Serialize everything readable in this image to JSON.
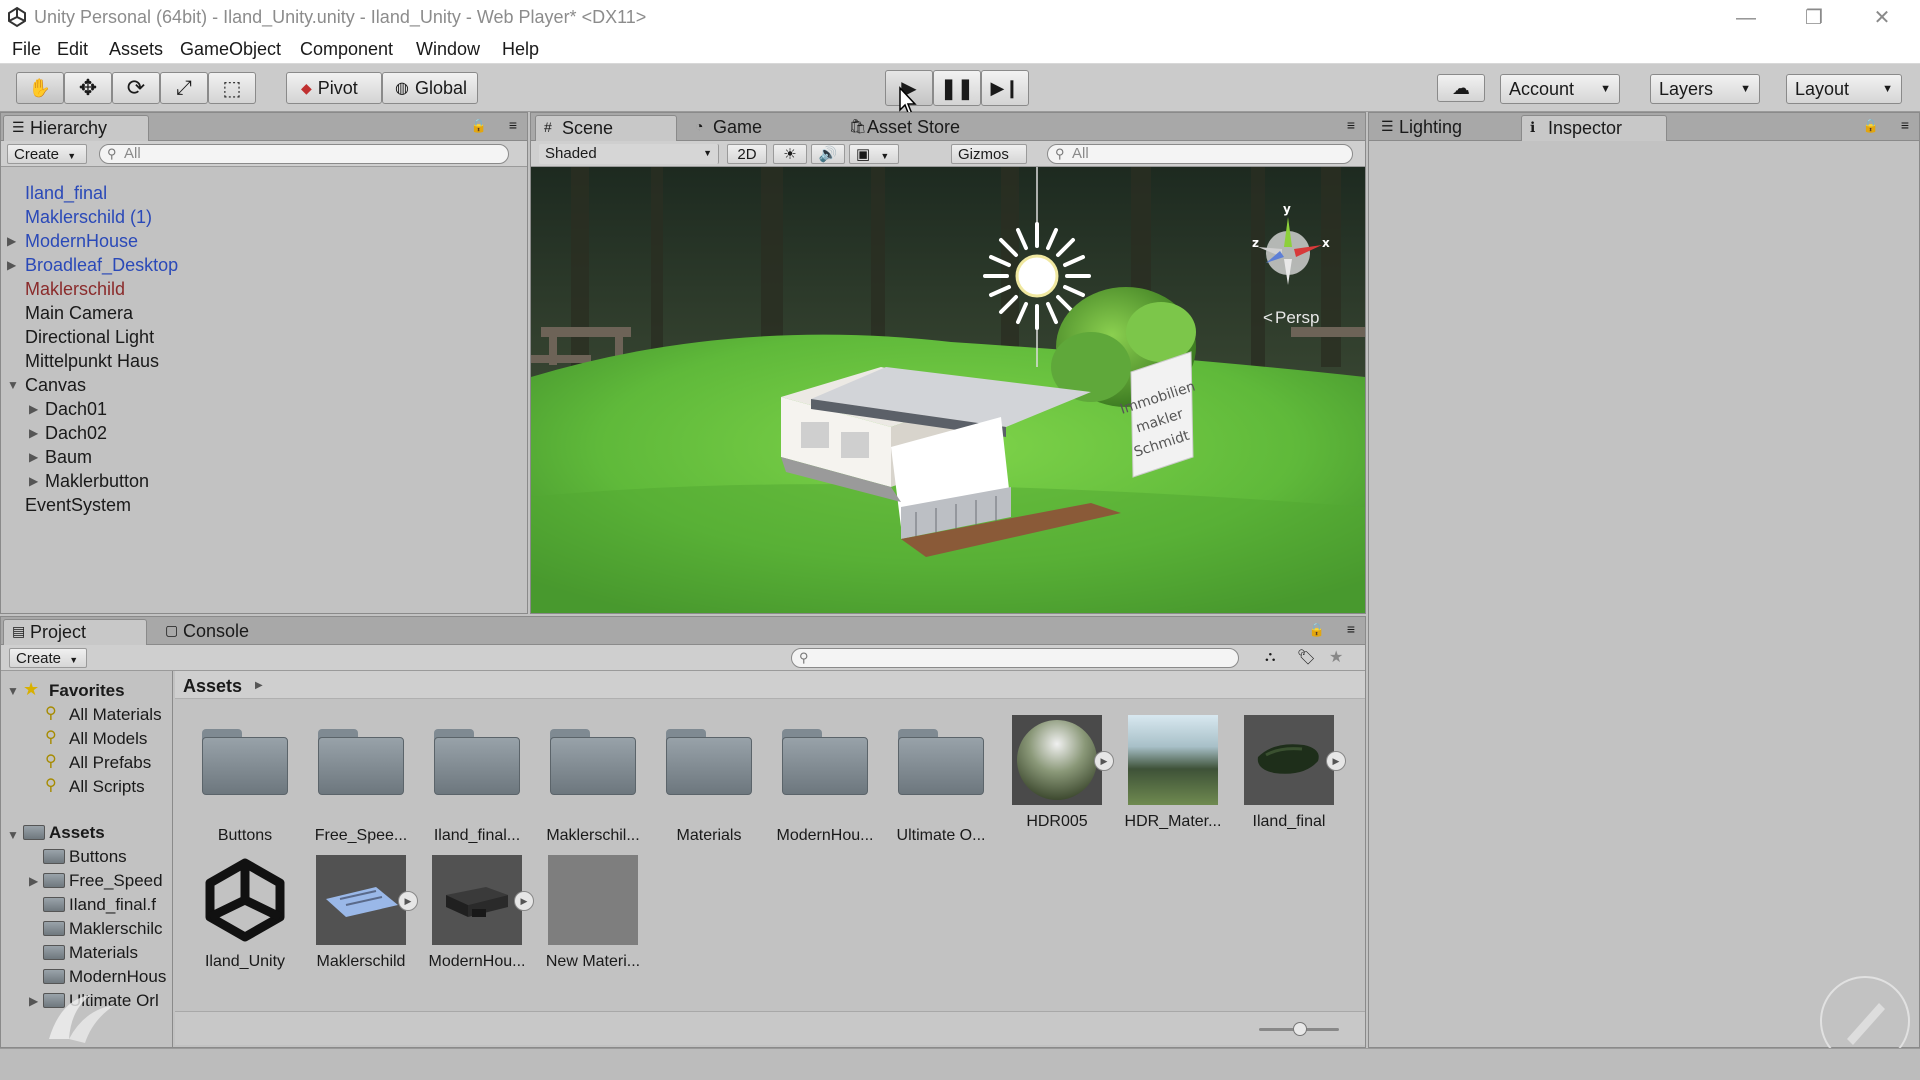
{
  "window": {
    "title": "Unity Personal (64bit) - Iland_Unity.unity - Iland_Unity - Web Player* <DX11>",
    "minimize_glyph": "—",
    "restore_glyph": "❐",
    "close_glyph": "✕"
  },
  "menu": [
    "File",
    "Edit",
    "Assets",
    "GameObject",
    "Component",
    "Window",
    "Help"
  ],
  "toolbar": {
    "pivot_label": "Pivot",
    "global_label": "Global",
    "account_label": "Account",
    "layers_label": "Layers",
    "layout_label": "Layout"
  },
  "hierarchy": {
    "tab_label": "Hierarchy",
    "create_label": "Create",
    "search_placeholder": "All",
    "items": [
      {
        "label": "Iland_final"
      },
      {
        "label": "Maklerschild (1)"
      },
      {
        "label": "ModernHouse"
      },
      {
        "label": "Broadleaf_Desktop"
      },
      {
        "label": "Maklerschild"
      },
      {
        "label": "Main Camera"
      },
      {
        "label": "Directional Light"
      },
      {
        "label": "Mittelpunkt Haus"
      },
      {
        "label": "Canvas"
      },
      {
        "label": "Dach01"
      },
      {
        "label": "Dach02"
      },
      {
        "label": "Baum"
      },
      {
        "label": "Maklerbutton"
      },
      {
        "label": "EventSystem"
      }
    ]
  },
  "scene": {
    "tabs": {
      "scene": "Scene",
      "game": "Game",
      "asset_store": "Asset Store"
    },
    "shading_label": "Shaded",
    "mode_2d_label": "2D",
    "gizmos_label": "Gizmos",
    "search_placeholder": "All",
    "persp_label": "Persp",
    "axis_y": "y",
    "axis_z": "z",
    "axis_x": "x",
    "sign_text": {
      "line1": "Immobilien",
      "line2": "makler",
      "line3": "Schmidt"
    }
  },
  "right_panel": {
    "lighting_label": "Lighting",
    "inspector_label": "Inspector"
  },
  "project": {
    "tabs": {
      "project": "Project",
      "console": "Console"
    },
    "create_label": "Create",
    "breadcrumb": "Assets",
    "favorites_label": "Favorites",
    "favorites": [
      "All Materials",
      "All Models",
      "All Prefabs",
      "All Scripts"
    ],
    "assets_label": "Assets",
    "assets_tree": [
      "Buttons",
      "Free_Speed",
      "Iland_final.f",
      "Maklerschilc",
      "Materials",
      "ModernHous",
      "Ultimate Orl"
    ],
    "grid_row1": [
      {
        "label": "Buttons",
        "kind": "folder"
      },
      {
        "label": "Free_Spee...",
        "kind": "folder"
      },
      {
        "label": "Iland_final...",
        "kind": "folder"
      },
      {
        "label": "Maklerschil...",
        "kind": "folder"
      },
      {
        "label": "Materials",
        "kind": "folder"
      },
      {
        "label": "ModernHou...",
        "kind": "folder"
      },
      {
        "label": "Ultimate O...",
        "kind": "folder"
      },
      {
        "label": "HDR005",
        "kind": "sphere"
      },
      {
        "label": "HDR_Mater...",
        "kind": "texture"
      },
      {
        "label": "Iland_final",
        "kind": "model"
      }
    ],
    "grid_row2": [
      {
        "label": "Iland_Unity",
        "kind": "unity"
      },
      {
        "label": "Maklerschild",
        "kind": "prefab"
      },
      {
        "label": "ModernHou...",
        "kind": "prefab"
      },
      {
        "label": "New Materi...",
        "kind": "material"
      }
    ]
  }
}
